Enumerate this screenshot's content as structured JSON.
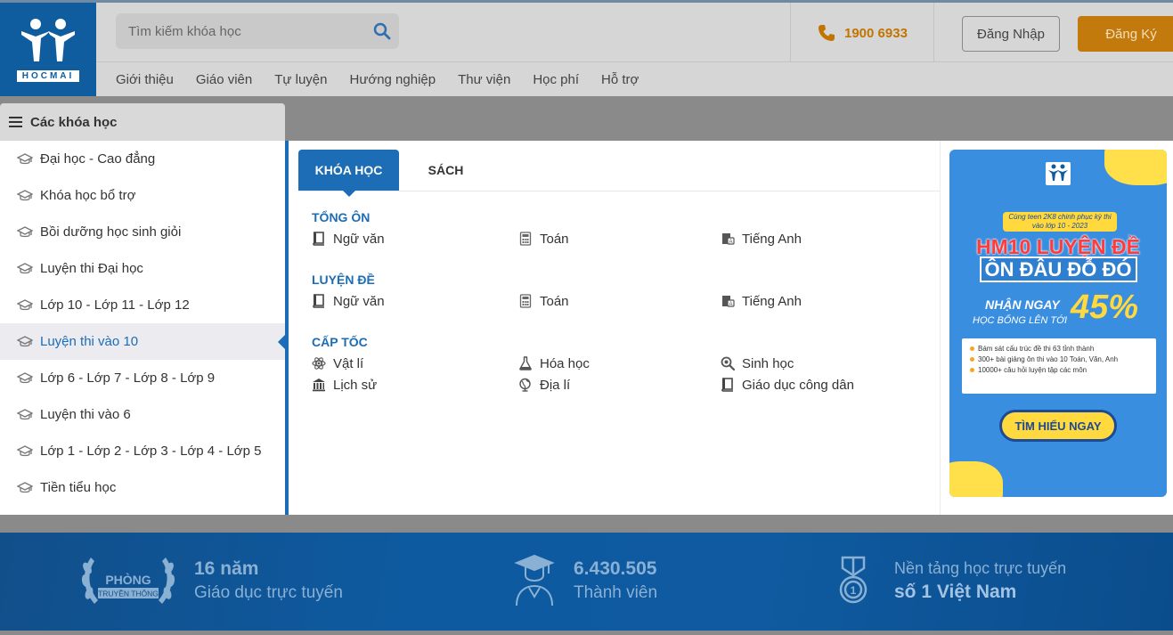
{
  "brand": {
    "logo_text": "HOCMAI"
  },
  "search": {
    "placeholder": "Tìm kiếm khóa học"
  },
  "contact": {
    "phone": "1900 6933"
  },
  "auth": {
    "login_label": "Đăng Nhập",
    "register_label": "Đăng Ký"
  },
  "nav": {
    "items": [
      "Giới thiệu",
      "Giáo viên",
      "Tự luyện",
      "Hướng nghiệp",
      "Thư viện",
      "Học phí",
      "Hỗ trợ"
    ]
  },
  "categories": {
    "title": "Các khóa học",
    "items": [
      "Đại học - Cao đẳng",
      "Khóa học bổ trợ",
      "Bồi dưỡng học sinh giỏi",
      "Luyện thi Đại học",
      "Lớp 10 - Lớp 11 - Lớp 12",
      "Luyện thi vào 10",
      "Lớp 6 - Lớp 7 - Lớp 8 - Lớp 9",
      "Luyện thi vào 6",
      "Lớp 1 - Lớp 2 - Lớp 3 - Lớp 4 - Lớp 5",
      "Tiền tiểu học"
    ],
    "active_index": 5
  },
  "tabs": [
    "KHÓA HỌC",
    "SÁCH"
  ],
  "sections": [
    {
      "title": "TỔNG ÔN",
      "courses": [
        [
          "Ngữ văn",
          "Toán",
          "Tiếng Anh"
        ]
      ]
    },
    {
      "title": "LUYỆN ĐỀ",
      "courses": [
        [
          "Ngữ văn",
          "Toán",
          "Tiếng Anh"
        ]
      ]
    },
    {
      "title": "CẤP TỐC",
      "courses": [
        [
          "Vật lí",
          "Hóa học",
          "Sinh học"
        ],
        [
          "Lịch sử",
          "Địa lí",
          "Giáo dục công dân"
        ]
      ]
    }
  ],
  "banner": {
    "tag": "Cùng teen 2K8 chinh phục kỳ thi vào lớp 10 - 2023",
    "headline": "HM10 LUYỆN ĐỀ",
    "subheadline": "ÔN ĐÂU ĐỖ ĐÓ",
    "gift_line1": "NHẬN NGAY",
    "gift_line2": "HỌC BỔNG LÊN TỚI",
    "percent": "45%",
    "notes": [
      "Bám sát cấu trúc đề thi 63 tỉnh thành",
      "300+ bài giảng ôn thi vào 10 Toán, Văn, Anh",
      "10000+ câu hỏi luyện tập các môn"
    ],
    "cta": "TÌM HIỂU NGAY"
  },
  "stats": [
    {
      "badge_line1": "PHÒNG",
      "badge_line2": "TRUYỀN THÔNG",
      "line1": "16 năm",
      "line2": "Giáo dục trực tuyến"
    },
    {
      "line1": "6.430.505",
      "line2": "Thành viên"
    },
    {
      "line1": "Nền tảng học trực tuyến",
      "line2": "số 1 Việt Nam"
    }
  ]
}
